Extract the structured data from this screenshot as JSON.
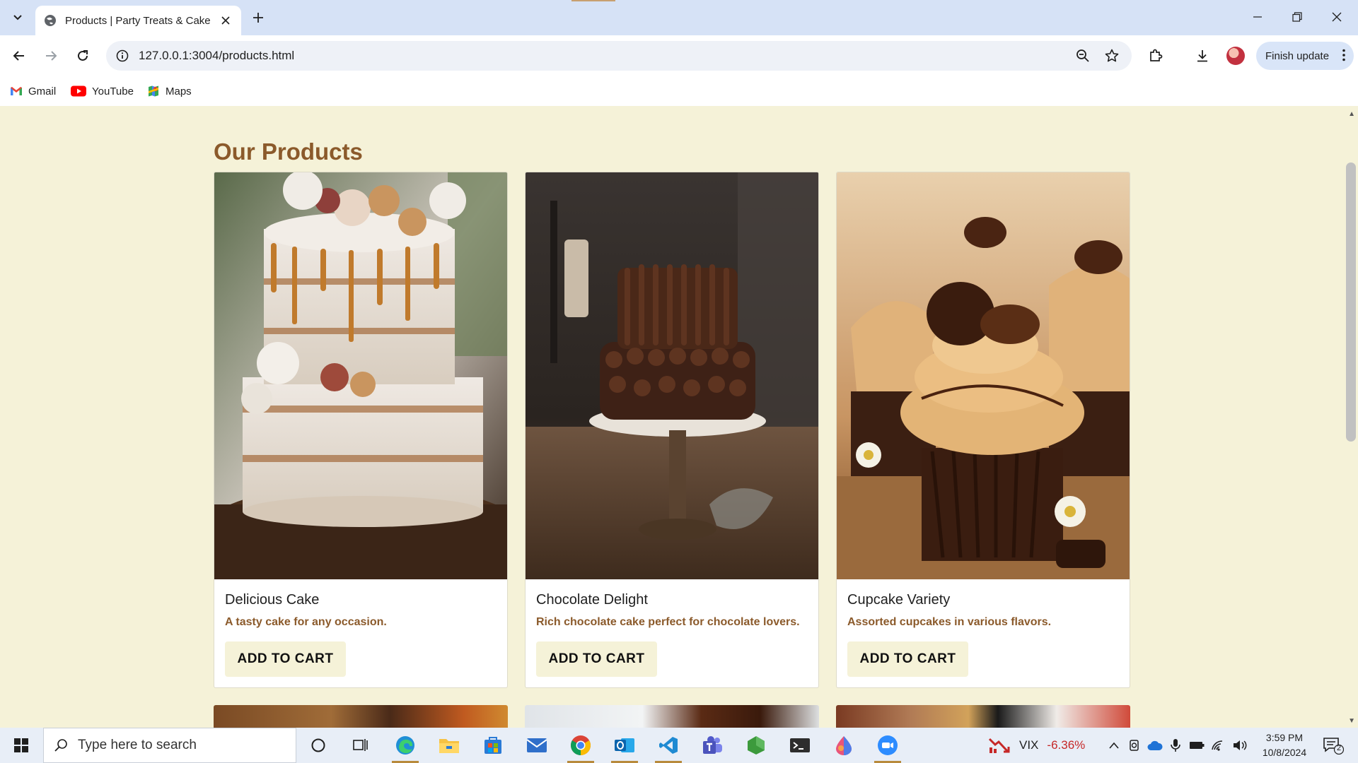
{
  "browser": {
    "tab_title": "Products | Party Treats & Cake",
    "url": "127.0.0.1:3004/products.html",
    "finish_update_label": "Finish update",
    "bookmarks": [
      {
        "label": "Gmail",
        "icon": "gmail-icon"
      },
      {
        "label": "YouTube",
        "icon": "youtube-icon"
      },
      {
        "label": "Maps",
        "icon": "maps-icon"
      }
    ]
  },
  "page": {
    "title": "Our Products",
    "products": [
      {
        "name": "Delicious Cake",
        "description": "A tasty cake for any occasion.",
        "button": "ADD TO CART",
        "image": "caramel-drip-naked-cake-photo"
      },
      {
        "name": "Chocolate Delight",
        "description": "Rich chocolate cake perfect for chocolate lovers.",
        "button": "ADD TO CART",
        "image": "chocolate-cake-on-stand-photo"
      },
      {
        "name": "Cupcake Variety",
        "description": "Assorted cupcakes in various flavors.",
        "button": "ADD TO CART",
        "image": "chocolate-peanut-butter-cupcakes-photo"
      }
    ]
  },
  "taskbar": {
    "search_placeholder": "Type here to search",
    "vix_label": "VIX",
    "vix_change": "-6.36%",
    "time": "3:59 PM",
    "date": "10/8/2024",
    "notification_count": "2"
  },
  "colors": {
    "page_background": "#f5f2d8",
    "heading": "#8b5a2b",
    "vix_negative": "#c62828"
  }
}
